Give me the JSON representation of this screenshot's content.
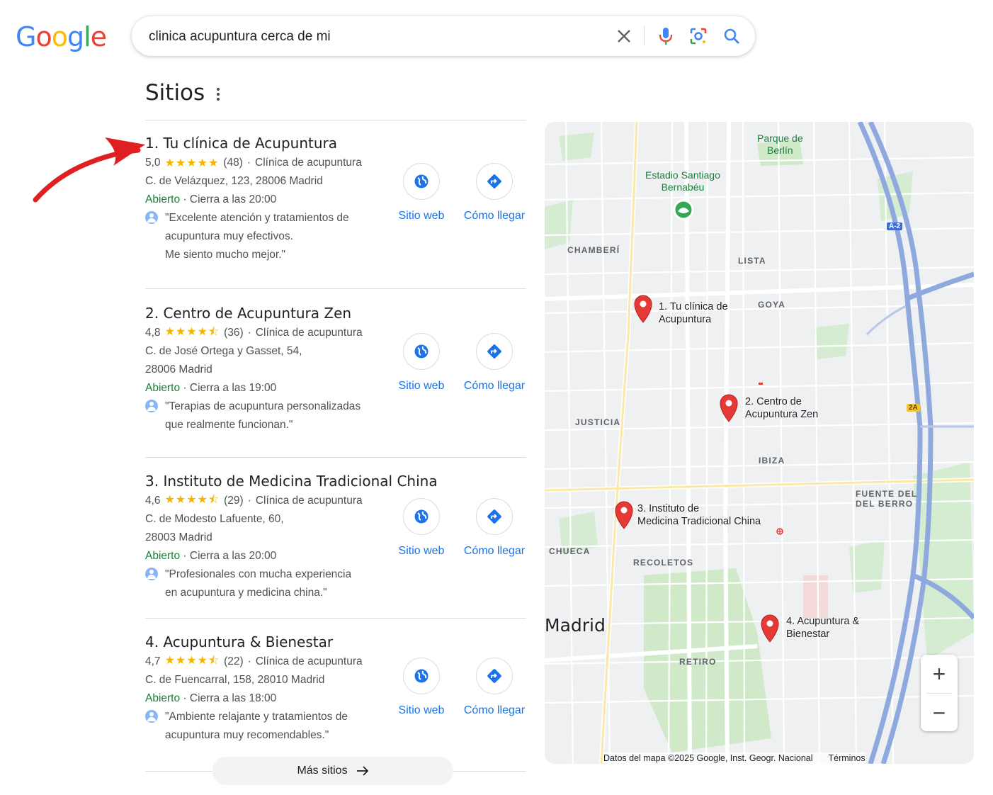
{
  "header": {
    "logo_text": "Google",
    "search_value": "clinica acupuntura cerca de mi"
  },
  "section": {
    "title": "Sitios"
  },
  "places": [
    {
      "name": "1. Tu clínica de Acupuntura",
      "rating": "5,0",
      "stars": "★★★★★",
      "reviews": "(48)",
      "category": "Clínica de acupuntura",
      "address_lines": [
        "C. de Velázquez, 123, 28006 Madrid"
      ],
      "status": "Abierto",
      "hours": "Cierra a las 20:00",
      "review_lines": [
        "\"Excelente atención y tratamientos de",
        "acupuntura muy efectivos.",
        "Me siento mucho mejor.\""
      ]
    },
    {
      "name": "2. Centro de Acupuntura Zen",
      "rating": "4,8",
      "stars": "★★★★⯪",
      "reviews": "(36)",
      "category": "Clínica de acupuntura",
      "address_lines": [
        "C. de José Ortega y Gasset, 54,",
        "28006 Madrid"
      ],
      "status": "Abierto",
      "hours": "Cierra a las 19:00",
      "review_lines": [
        "\"Terapias de acupuntura personalizadas",
        "que realmente funcionan.\""
      ]
    },
    {
      "name": "3. Instituto de Medicina Tradicional China",
      "rating": "4,6",
      "stars": "★★★★⯪",
      "reviews": "(29)",
      "category": "Clínica de acupuntura",
      "address_lines": [
        "C. de Modesto Lafuente, 60,",
        "28003 Madrid"
      ],
      "status": "Abierto",
      "hours": "Cierra a las 20:00",
      "review_lines": [
        "\"Profesionales con mucha experiencia",
        "en acupuntura y medicina china.\""
      ]
    },
    {
      "name": "4. Acupuntura & Bienestar",
      "rating": "4,7",
      "stars": "★★★★⯪",
      "reviews": "(22)",
      "category": "Clínica de acupuntura",
      "address_lines": [
        "C. de Fuencarral, 158, 28010 Madrid"
      ],
      "status": "Abierto",
      "hours": "Cierra a las 18:00",
      "review_lines": [
        "\"Ambiente relajante y tratamientos de",
        "acupuntura muy recomendables.\""
      ]
    }
  ],
  "actions": {
    "website": "Sitio web",
    "directions": "Cómo llegar"
  },
  "more_label": "Más sitios",
  "map": {
    "city": "Madrid",
    "districts": [
      "CHAMBERÍ",
      "LISTA",
      "GOYA",
      "JUSTICIA",
      "IBIZA",
      "FUENTE DEL",
      "DEL BERRO",
      "CHUECA",
      "RECOLETOS",
      "RETIRO"
    ],
    "poi_park": [
      "Parque de",
      "Berlín"
    ],
    "poi_stadium": [
      "Estadio Santiago",
      "Bernabéu"
    ],
    "pin_labels": [
      [
        "1. Tu clínica de",
        "Acupuntura"
      ],
      [
        "2. Centro de",
        "Acupuntura Zen"
      ],
      [
        "3. Instituto de",
        "Medicina Tradicional China"
      ],
      [
        "4. Acupuntura &",
        "Bienestar"
      ]
    ],
    "highway_a2": "A-2",
    "highway_2a": "2A",
    "attribution": "Datos del mapa ©2025 Google, Inst. Geogr. Nacional",
    "terms": "Términos",
    "zoom_in": "+",
    "zoom_out": "−"
  },
  "colors": {
    "accent": "#1a73e8",
    "open": "#188038",
    "star": "#f4b400",
    "pin": "#e53935"
  }
}
